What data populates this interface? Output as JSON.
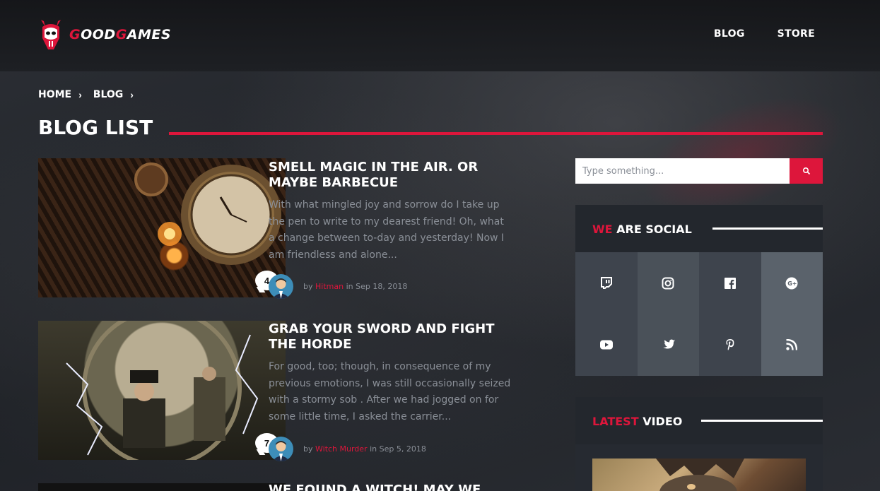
{
  "brand": {
    "name_part1": "G",
    "name_part2": "OOD",
    "name_part3": "G",
    "name_part4": "AMES",
    "accent_color": "#dd163b"
  },
  "nav": {
    "items": [
      "BLOG",
      "STORE"
    ]
  },
  "breadcrumb": {
    "items": [
      "HOME",
      "BLOG"
    ]
  },
  "page": {
    "title": "BLOG LIST"
  },
  "posts": [
    {
      "title": "SMELL MAGIC IN THE AIR. OR MAYBE BARBECUE",
      "excerpt": "With what mingled joy and sorrow do I take up the pen to write to my dearest friend! Oh, what a change between to-day and yesterday! Now I am friendless and alone...",
      "comments": "4",
      "meta_by": "by",
      "author": "Hitman",
      "meta_in": "in",
      "date": "Sep 18, 2018",
      "image_icon": "steampunk-clock-image"
    },
    {
      "title": "GRAB YOUR SWORD AND FIGHT THE HORDE",
      "excerpt": "For good, too; though, in consequence of my previous emotions, I was still occasionally seized with a stormy sob . After we had jogged on for some little time, I asked the carrier...",
      "comments": "7",
      "meta_by": "by",
      "author": "Witch Murder",
      "meta_in": "in",
      "date": "Sep 5, 2018",
      "image_icon": "fantasy-clock-scene-image"
    },
    {
      "title": "WE FOUND A WITCH! MAY WE"
    }
  ],
  "search": {
    "placeholder": "Type something..."
  },
  "social_widget": {
    "title_accent": "WE",
    "title_rest": "ARE SOCIAL",
    "icons": [
      "twitch-icon",
      "instagram-icon",
      "facebook-icon",
      "google-plus-icon",
      "youtube-icon",
      "twitter-icon",
      "pinterest-icon",
      "rss-icon"
    ],
    "cell_colors": [
      "#3e444d",
      "#4a5159",
      "#3e444d",
      "#5a626b",
      "#3e444d",
      "#4a5159",
      "#3e444d",
      "#5a626b"
    ]
  },
  "video_widget": {
    "title_accent": "LATEST",
    "title_rest": "VIDEO"
  }
}
